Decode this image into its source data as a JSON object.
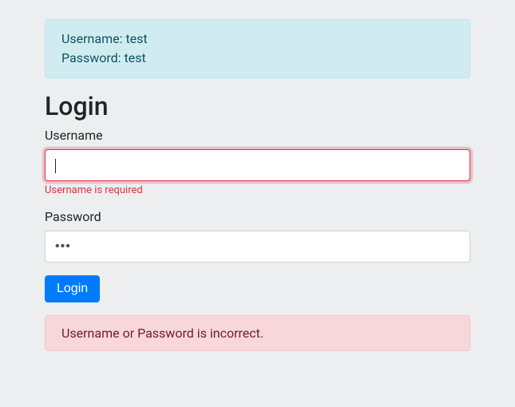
{
  "hint": {
    "line1": "Username: test",
    "line2": "Password: test"
  },
  "title": "Login",
  "username": {
    "label": "Username",
    "value": "",
    "error": "Username is required"
  },
  "password": {
    "label": "Password",
    "value": "•••"
  },
  "submit_label": "Login",
  "error_message": "Username or Password is incorrect."
}
